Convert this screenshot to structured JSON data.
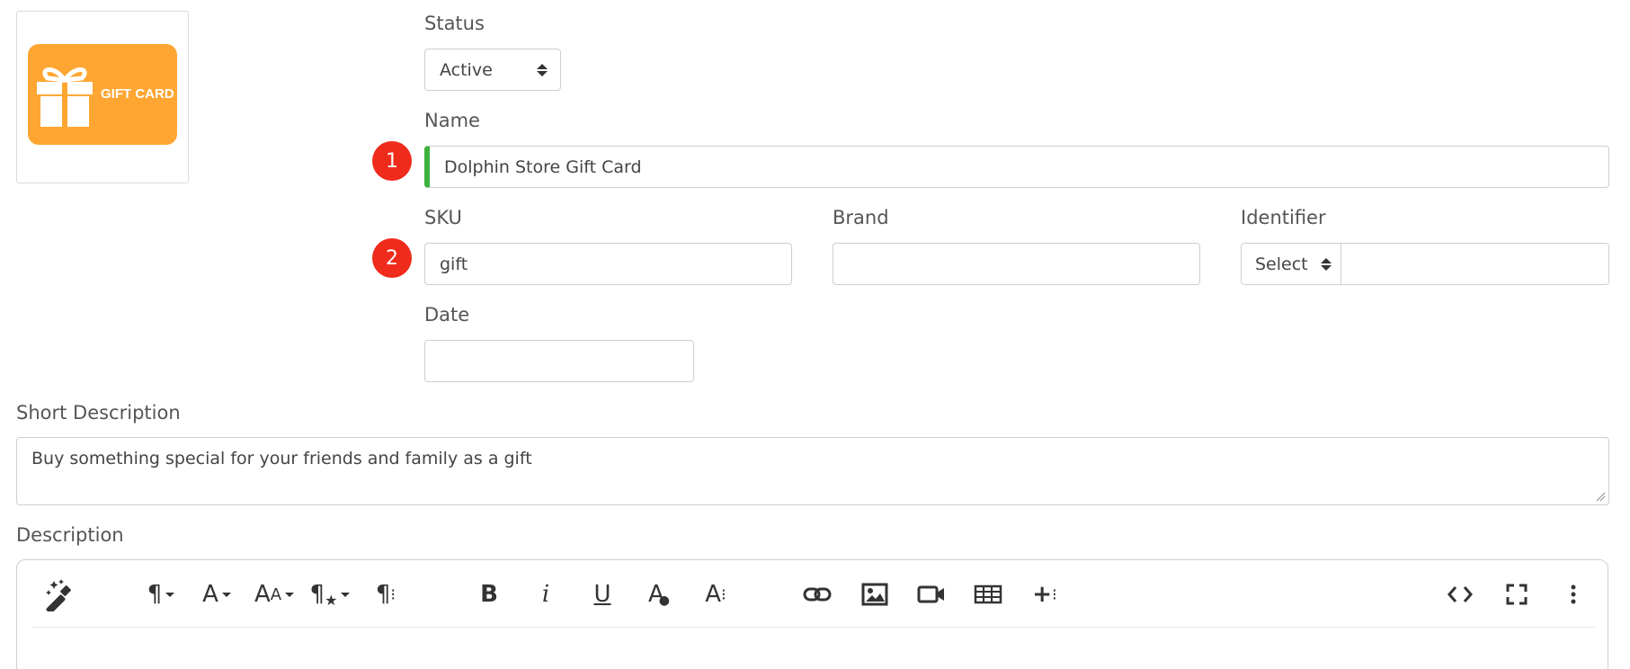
{
  "product_image": {
    "label": "GIFT CARD",
    "icon": "gift-box-icon",
    "colors": {
      "card": "#ffa632",
      "text": "#ffffff"
    }
  },
  "status": {
    "label": "Status",
    "value": "Active"
  },
  "name": {
    "label": "Name",
    "value": "Dolphin Store Gift Card",
    "marker": "1",
    "valid_color": "#3db33d"
  },
  "sku": {
    "label": "SKU",
    "value": "gift",
    "marker": "2"
  },
  "brand": {
    "label": "Brand",
    "value": ""
  },
  "identifier": {
    "label": "Identifier",
    "select_value": "Select",
    "value": ""
  },
  "date": {
    "label": "Date",
    "value": ""
  },
  "short_description": {
    "label": "Short Description",
    "value": "Buy something special for your friends and family as a gift"
  },
  "description": {
    "label": "Description",
    "toolbar": [
      "magic-wand-icon",
      "paragraph-format-icon",
      "font-family-icon",
      "font-size-icon",
      "paragraph-style-icon",
      "more-paragraph-icon",
      "bold-icon",
      "italic-icon",
      "underline-icon",
      "text-color-icon",
      "more-text-icon",
      "link-icon",
      "image-icon",
      "video-icon",
      "table-icon",
      "more-insert-icon",
      "code-view-icon",
      "fullscreen-icon",
      "more-options-icon"
    ]
  },
  "colors": {
    "marker": "#ef2b1c",
    "border": "#cfcfcf"
  }
}
